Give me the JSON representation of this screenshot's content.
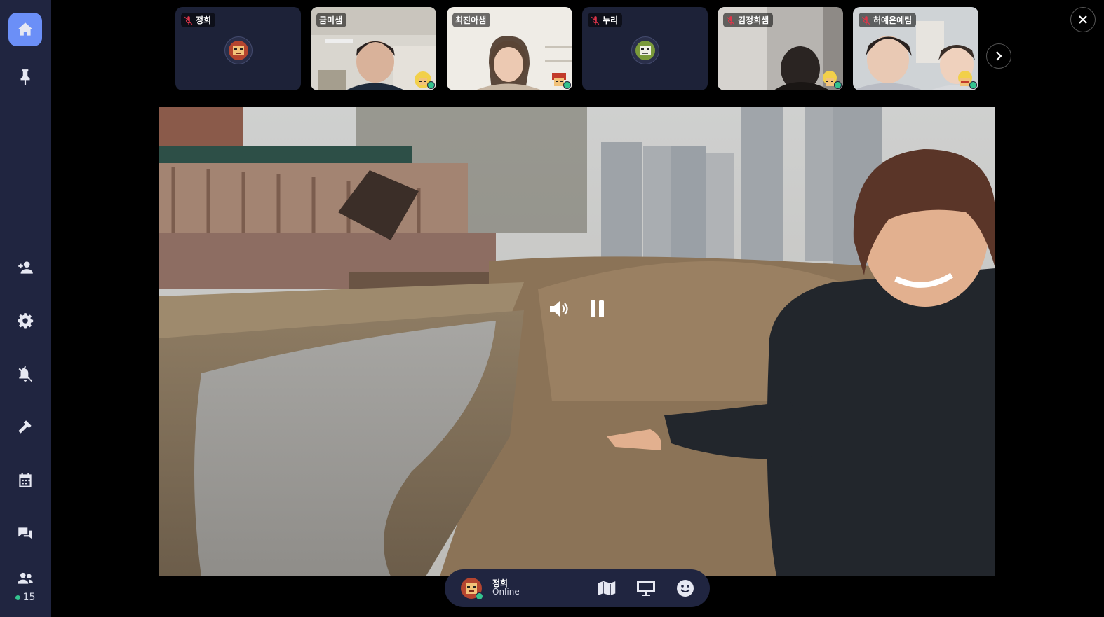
{
  "sidebar": {
    "items": [
      {
        "name": "home",
        "icon": "home-icon"
      },
      {
        "name": "pin",
        "icon": "pin-icon"
      },
      {
        "name": "invite",
        "icon": "user-plus-icon"
      },
      {
        "name": "settings",
        "icon": "gear-icon"
      },
      {
        "name": "notifications",
        "icon": "bell-off-icon"
      },
      {
        "name": "build",
        "icon": "hammer-icon"
      },
      {
        "name": "calendar",
        "icon": "calendar-icon"
      },
      {
        "name": "chat",
        "icon": "chat-icon"
      },
      {
        "name": "participants",
        "icon": "users-icon"
      }
    ],
    "participant_count": "15"
  },
  "participants": [
    {
      "name": "정희",
      "muted": true,
      "camera": false
    },
    {
      "name": "금미샘",
      "muted": false,
      "camera": true
    },
    {
      "name": "최진아샘",
      "muted": false,
      "camera": true
    },
    {
      "name": "누리",
      "muted": true,
      "camera": false
    },
    {
      "name": "김정희샘",
      "muted": true,
      "camera": true
    },
    {
      "name": "허예은예림",
      "muted": true,
      "camera": true
    }
  ],
  "video_controls": {
    "volume_icon": "volume-icon",
    "pause_icon": "pause-icon"
  },
  "bottom_bar": {
    "user_name": "정희",
    "status": "Online",
    "buttons": [
      "map-icon",
      "screen-share-icon",
      "emoji-icon"
    ]
  },
  "colors": {
    "sidebar": "#202540",
    "accent": "#6b8ff7",
    "online": "#34c38f",
    "muted": "#e0354a"
  }
}
